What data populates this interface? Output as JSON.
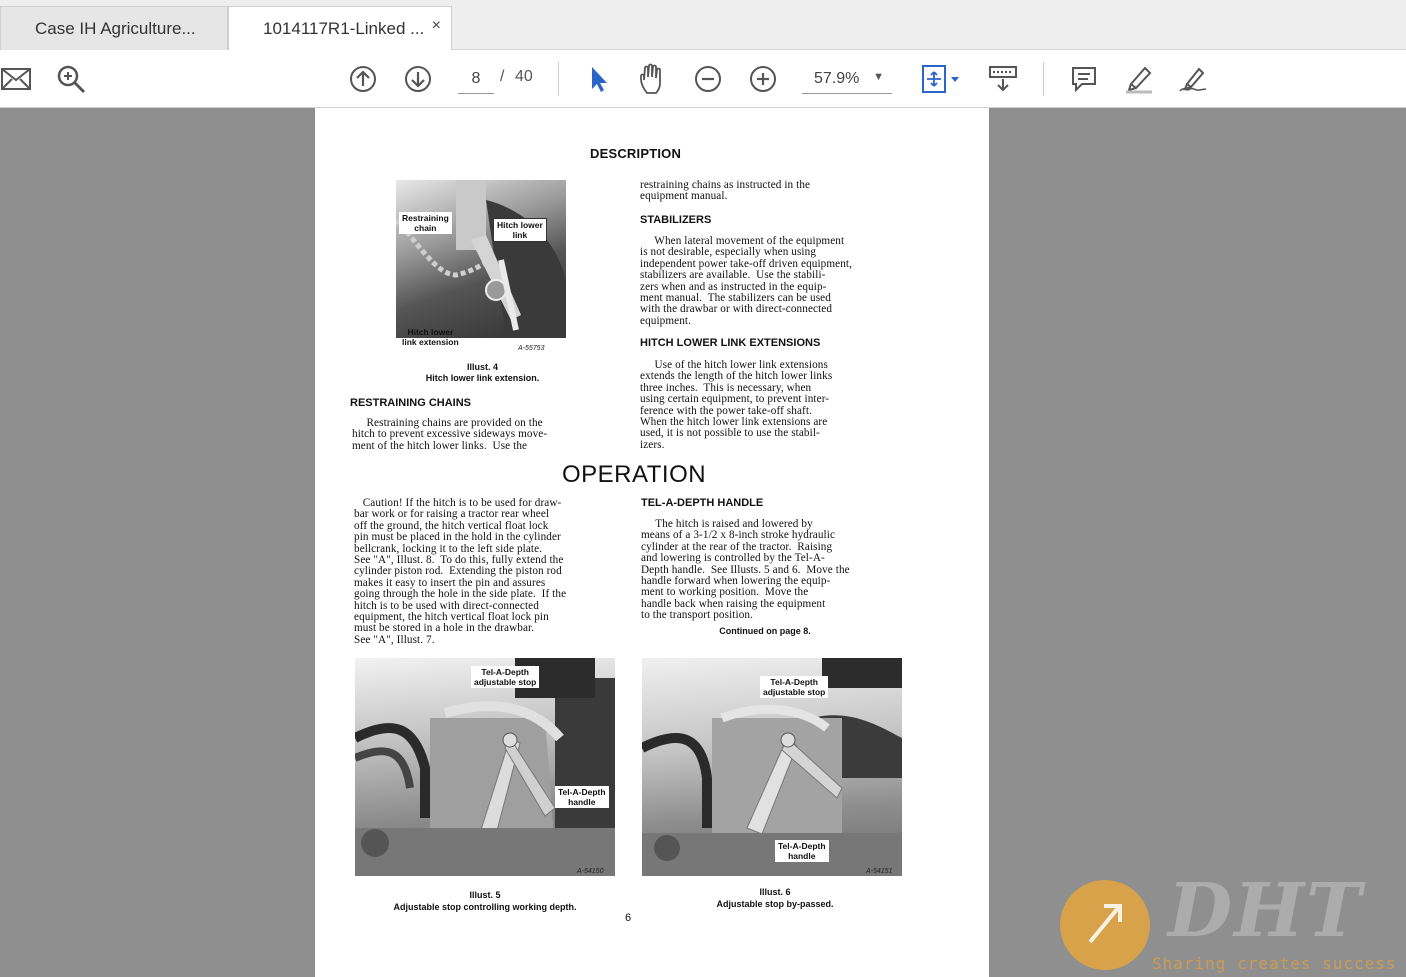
{
  "tabs": [
    {
      "label": "Case IH Agriculture..."
    },
    {
      "label": "1014117R1-Linked ...",
      "close": "×"
    }
  ],
  "toolbar": {
    "page_current": "8",
    "page_separator": "/",
    "page_total": "40",
    "zoom": "57.9%",
    "icons": [
      "mail-icon",
      "search-icon",
      "page-up-icon",
      "page-down-icon",
      "select-pointer-icon",
      "hand-icon",
      "zoom-out-icon",
      "zoom-in-icon",
      "fit-page-icon",
      "scroll-mode-icon",
      "comment-icon",
      "highlight-icon",
      "sign-icon"
    ]
  },
  "document": {
    "heading_description": "DESCRIPTION",
    "heading_operation": "OPERATION",
    "fig4": {
      "callout_chain": "Restraining\nchain",
      "callout_lower_link": "Hitch lower\nlink",
      "callout_extension": "Hitch lower\nlink extension",
      "code": "A-55753",
      "caption_num": "Illust. 4",
      "caption_text": "Hitch lower link extension."
    },
    "restraining_chains": {
      "title": "RESTRAINING CHAINS",
      "body": "     Restraining chains are provided on the\nhitch to prevent excessive sideways move-\nment of the hitch lower links.  Use the"
    },
    "right_col_top": "restraining chains as instructed in the\nequipment manual.",
    "stabilizers": {
      "title": "STABILIZERS",
      "body": "     When lateral movement of the equipment\nis not desirable, especially when using\nindependent power take-off driven equipment,\nstabilizers are available.  Use the stabili-\nzers when and as instructed in the equip-\nment manual.  The stabilizers can be used\nwith the drawbar or with direct-connected\nequipment."
    },
    "extensions": {
      "title": "HITCH LOWER LINK EXTENSIONS",
      "body": "     Use of the hitch lower link extensions\nextends the length of the hitch lower links\nthree inches.  This is necessary, when\nusing certain equipment, to prevent inter-\nference with the power take-off shaft.\nWhen the hitch lower link extensions are\nused, it is not possible to use the stabil-\nizers."
    },
    "caution": "   Caution! If the hitch is to be used for draw-\nbar work or for raising a tractor rear wheel\noff the ground, the hitch vertical float lock\npin must be placed in the hold in the cylinder\nbellcrank, locking it to the left side plate.\nSee \"A\", Illust. 8.  To do this, fully extend the\ncylinder piston rod.  Extending the piston rod\nmakes it easy to insert the pin and assures\ngoing through the hole in the side plate.  If the\nhitch is to be used with direct-connected\nequipment, the hitch vertical float lock pin\nmust be stored in a hole in the drawbar.\nSee \"A\", Illust. 7.",
    "tel_a_depth": {
      "title": "TEL-A-DEPTH HANDLE",
      "body": "     The hitch is raised and lowered by\nmeans of a 3-1/2 x 8-inch stroke hydraulic\ncylinder at the rear of the tractor.  Raising\nand lowering is controlled by the Tel-A-\nDepth handle.  See Illusts. 5 and 6.  Move the\nhandle forward when lowering the equip-\nment to working position.  Move the\nhandle back when raising the equipment\nto the transport position.",
      "continued": "Continued on page 8."
    },
    "fig5": {
      "callout_stop": "Tel-A-Depth\nadjustable stop",
      "callout_handle": "Tel-A-Depth\nhandle",
      "code": "A-54150",
      "caption_num": "Illust. 5",
      "caption_text": "Adjustable stop controlling working depth."
    },
    "fig6": {
      "callout_stop": "Tel-A-Depth\nadjustable stop",
      "callout_handle": "Tel-A-Depth\nhandle",
      "code": "A-54151",
      "caption_num": "Illust. 6",
      "caption_text": "Adjustable stop by-passed."
    },
    "page_number": "6"
  },
  "watermark": {
    "brand": "DHT",
    "tagline": "Sharing creates success"
  }
}
